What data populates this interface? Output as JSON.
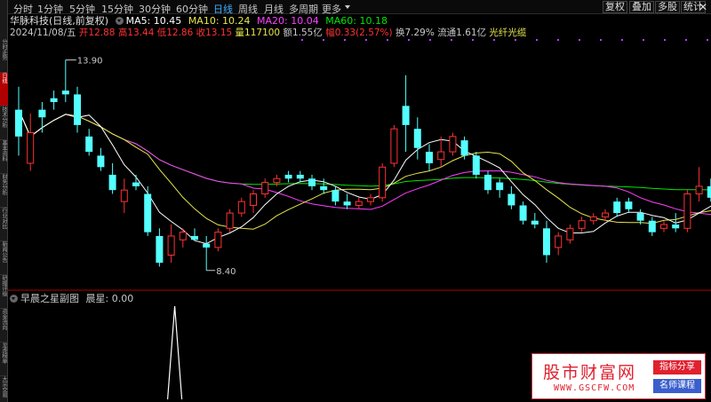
{
  "toolbar": {
    "periods": [
      "分时",
      "1分钟",
      "5分钟",
      "15分钟",
      "30分钟",
      "60分钟",
      "日线",
      "周线",
      "月线",
      "多周期",
      "更多"
    ],
    "active_period": "日线",
    "right_buttons": [
      "复权",
      "叠加",
      "多股",
      "统计"
    ],
    "close_icon": "close-icon"
  },
  "stock": {
    "name_line": "华脉科技(日线,前复权)",
    "ma5": "MA5: 10.45",
    "ma10": "MA10: 10.24",
    "ma20": "MA20: 10.04",
    "ma60": "MA60: 10.18",
    "date": "2024/11/08/五",
    "open": "开12.88",
    "high": "高13.44",
    "low": "低12.86",
    "close": "收13.15",
    "volume": "量117100",
    "amount": "额1.55亿",
    "change": "幅0.33(2.57%)",
    "turnover": "换7.29%",
    "float_cap": "流通1.61亿",
    "concept": "光纤光缆"
  },
  "chart_annotations": {
    "high_label": "13.90",
    "low_label": "8.40"
  },
  "sub_panel": {
    "title": "早晨之星副图",
    "value_label": "晨星: 0.00"
  },
  "side_tabs": [
    "分时走势",
    "日线",
    "技术分析",
    "基本资料",
    "财务分析",
    "行业对比",
    "新闻公告",
    "研报评级",
    "资金流向",
    "龙虎榜单",
    "大宗交易"
  ],
  "watermark": {
    "brand": "股市财富网",
    "url": "WWW.GSCFW.COM",
    "tag1": "指标分享",
    "tag2": "名师课程"
  },
  "colors": {
    "up": "#ff3232",
    "down": "#54ffff",
    "ma5": "#ffffff",
    "ma10": "#e6e64d",
    "ma20": "#ff40ff",
    "ma60": "#00e600",
    "active_tab": "#3fb0ff",
    "background": "#000000"
  },
  "chart_data": {
    "type": "candlestick",
    "price_range_visible": [
      8.4,
      13.9
    ],
    "high_marker": 13.9,
    "low_marker": 8.4,
    "candles": [
      {
        "o": 11.9,
        "h": 13.2,
        "l": 11.4,
        "c": 12.6,
        "dir": "down"
      },
      {
        "o": 12.0,
        "h": 12.5,
        "l": 11.0,
        "c": 11.2,
        "dir": "up"
      },
      {
        "o": 12.4,
        "h": 12.8,
        "l": 12.0,
        "c": 12.6,
        "dir": "down"
      },
      {
        "o": 12.8,
        "h": 13.1,
        "l": 12.6,
        "c": 12.9,
        "dir": "down"
      },
      {
        "o": 13.0,
        "h": 13.9,
        "l": 12.8,
        "c": 13.1,
        "dir": "down"
      },
      {
        "o": 13.0,
        "h": 13.2,
        "l": 12.0,
        "c": 12.2,
        "dir": "down"
      },
      {
        "o": 11.9,
        "h": 12.1,
        "l": 11.4,
        "c": 11.5,
        "dir": "down"
      },
      {
        "o": 11.4,
        "h": 11.6,
        "l": 11.0,
        "c": 11.1,
        "dir": "down"
      },
      {
        "o": 10.9,
        "h": 11.2,
        "l": 10.4,
        "c": 10.5,
        "dir": "down"
      },
      {
        "o": 10.2,
        "h": 10.8,
        "l": 9.9,
        "c": 10.5,
        "dir": "up"
      },
      {
        "o": 10.7,
        "h": 10.9,
        "l": 10.5,
        "c": 10.6,
        "dir": "down"
      },
      {
        "o": 10.4,
        "h": 10.6,
        "l": 9.3,
        "c": 9.4,
        "dir": "down"
      },
      {
        "o": 9.3,
        "h": 9.5,
        "l": 8.5,
        "c": 8.6,
        "dir": "down"
      },
      {
        "o": 8.8,
        "h": 9.6,
        "l": 8.6,
        "c": 9.3,
        "dir": "up"
      },
      {
        "o": 9.2,
        "h": 9.5,
        "l": 9.0,
        "c": 9.4,
        "dir": "up"
      },
      {
        "o": 9.3,
        "h": 9.5,
        "l": 9.2,
        "c": 9.2,
        "dir": "down"
      },
      {
        "o": 9.1,
        "h": 9.3,
        "l": 8.4,
        "c": 9.0,
        "dir": "down"
      },
      {
        "o": 9.0,
        "h": 9.5,
        "l": 8.9,
        "c": 9.4,
        "dir": "up"
      },
      {
        "o": 9.5,
        "h": 10.0,
        "l": 9.4,
        "c": 9.9,
        "dir": "up"
      },
      {
        "o": 9.9,
        "h": 10.3,
        "l": 9.8,
        "c": 10.2,
        "dir": "up"
      },
      {
        "o": 10.1,
        "h": 10.5,
        "l": 9.9,
        "c": 10.4,
        "dir": "up"
      },
      {
        "o": 10.4,
        "h": 10.8,
        "l": 10.3,
        "c": 10.7,
        "dir": "up"
      },
      {
        "o": 10.7,
        "h": 10.9,
        "l": 10.6,
        "c": 10.8,
        "dir": "up"
      },
      {
        "o": 10.8,
        "h": 11.0,
        "l": 10.7,
        "c": 10.9,
        "dir": "down"
      },
      {
        "o": 10.9,
        "h": 11.0,
        "l": 10.7,
        "c": 10.8,
        "dir": "down"
      },
      {
        "o": 10.8,
        "h": 10.9,
        "l": 10.5,
        "c": 10.6,
        "dir": "down"
      },
      {
        "o": 10.6,
        "h": 10.8,
        "l": 10.4,
        "c": 10.5,
        "dir": "down"
      },
      {
        "o": 10.5,
        "h": 10.6,
        "l": 10.1,
        "c": 10.2,
        "dir": "down"
      },
      {
        "o": 10.2,
        "h": 10.4,
        "l": 10.0,
        "c": 10.1,
        "dir": "down"
      },
      {
        "o": 10.1,
        "h": 10.3,
        "l": 10.0,
        "c": 10.2,
        "dir": "up"
      },
      {
        "o": 10.2,
        "h": 10.4,
        "l": 10.1,
        "c": 10.3,
        "dir": "up"
      },
      {
        "o": 10.3,
        "h": 11.2,
        "l": 10.2,
        "c": 11.1,
        "dir": "up"
      },
      {
        "o": 11.2,
        "h": 12.2,
        "l": 11.1,
        "c": 12.1,
        "dir": "up"
      },
      {
        "o": 12.2,
        "h": 13.5,
        "l": 11.5,
        "c": 12.7,
        "dir": "down"
      },
      {
        "o": 12.1,
        "h": 12.4,
        "l": 11.3,
        "c": 11.6,
        "dir": "down"
      },
      {
        "o": 11.5,
        "h": 11.7,
        "l": 11.0,
        "c": 11.2,
        "dir": "down"
      },
      {
        "o": 11.3,
        "h": 11.9,
        "l": 11.1,
        "c": 11.5,
        "dir": "up"
      },
      {
        "o": 11.5,
        "h": 12.0,
        "l": 11.4,
        "c": 11.9,
        "dir": "up"
      },
      {
        "o": 11.8,
        "h": 11.9,
        "l": 11.3,
        "c": 11.4,
        "dir": "down"
      },
      {
        "o": 11.4,
        "h": 11.5,
        "l": 10.8,
        "c": 10.9,
        "dir": "down"
      },
      {
        "o": 10.9,
        "h": 11.0,
        "l": 10.4,
        "c": 10.5,
        "dir": "down"
      },
      {
        "o": 10.5,
        "h": 10.8,
        "l": 10.3,
        "c": 10.7,
        "dir": "down"
      },
      {
        "o": 10.4,
        "h": 10.6,
        "l": 10.0,
        "c": 10.1,
        "dir": "down"
      },
      {
        "o": 10.1,
        "h": 10.2,
        "l": 9.6,
        "c": 9.7,
        "dir": "down"
      },
      {
        "o": 9.7,
        "h": 9.9,
        "l": 9.5,
        "c": 9.6,
        "dir": "down"
      },
      {
        "o": 9.5,
        "h": 9.7,
        "l": 8.6,
        "c": 8.8,
        "dir": "down"
      },
      {
        "o": 9.0,
        "h": 9.4,
        "l": 8.8,
        "c": 9.3,
        "dir": "up"
      },
      {
        "o": 9.2,
        "h": 9.6,
        "l": 9.1,
        "c": 9.5,
        "dir": "up"
      },
      {
        "o": 9.5,
        "h": 9.8,
        "l": 9.4,
        "c": 9.7,
        "dir": "up"
      },
      {
        "o": 9.7,
        "h": 9.9,
        "l": 9.6,
        "c": 9.8,
        "dir": "up"
      },
      {
        "o": 9.8,
        "h": 10.0,
        "l": 9.7,
        "c": 9.9,
        "dir": "up"
      },
      {
        "o": 9.9,
        "h": 10.3,
        "l": 9.8,
        "c": 10.2,
        "dir": "down"
      },
      {
        "o": 10.2,
        "h": 10.3,
        "l": 9.9,
        "c": 10.0,
        "dir": "down"
      },
      {
        "o": 9.9,
        "h": 10.0,
        "l": 9.6,
        "c": 9.7,
        "dir": "down"
      },
      {
        "o": 9.7,
        "h": 9.8,
        "l": 9.3,
        "c": 9.4,
        "dir": "down"
      },
      {
        "o": 9.5,
        "h": 9.7,
        "l": 9.4,
        "c": 9.6,
        "dir": "up"
      },
      {
        "o": 9.6,
        "h": 9.9,
        "l": 9.4,
        "c": 9.5,
        "dir": "down"
      },
      {
        "o": 9.5,
        "h": 10.5,
        "l": 9.4,
        "c": 10.4,
        "dir": "up"
      },
      {
        "o": 10.4,
        "h": 11.1,
        "l": 10.2,
        "c": 10.6,
        "dir": "up"
      },
      {
        "o": 10.6,
        "h": 10.8,
        "l": 10.2,
        "c": 10.3,
        "dir": "down"
      },
      {
        "o": 10.3,
        "h": 10.4,
        "l": 10.0,
        "c": 10.1,
        "dir": "down"
      }
    ],
    "sub_series": {
      "name": "晨星",
      "spike_index": 13,
      "spike_value": 1
    }
  }
}
